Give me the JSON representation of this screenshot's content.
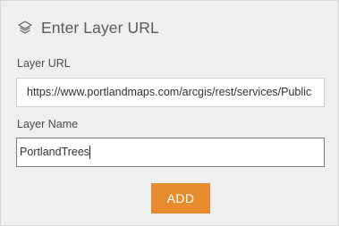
{
  "dialog": {
    "title": "Enter Layer URL",
    "title_icon": "layers-icon"
  },
  "form": {
    "url_label": "Layer URL",
    "url_value": "https://www.portlandmaps.com/arcgis/rest/services/Public",
    "name_label": "Layer Name",
    "name_value": "PortlandTrees",
    "add_label": "ADD"
  },
  "colors": {
    "accent": "#e68c2d",
    "panel_background": "#efefef",
    "focused_border": "#7a7f88"
  }
}
